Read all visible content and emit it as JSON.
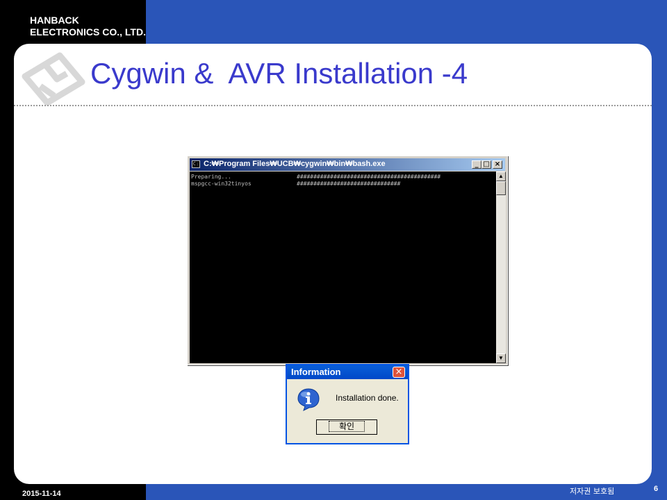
{
  "header": {
    "company_line1": "HANBACK",
    "company_line2": "ELECTRONICS CO., LTD."
  },
  "slide": {
    "title": "Cygwin &  AVR Installation -4"
  },
  "console_window": {
    "title": "C:\\Program Files\\UCB\\cygwin\\bin\\bash.exe",
    "title_display": "C:₩Program Files₩UCB₩cygwin₩bin₩bash.exe",
    "app_icon_text": "C:\\",
    "minimize_label": "_",
    "maximize_label": "□",
    "close_label": "×",
    "lines": [
      {
        "label": "Preparing...",
        "progress": "###########################################"
      },
      {
        "label": "mspgcc-win32tinyos",
        "progress": "###############################"
      }
    ]
  },
  "dialog": {
    "title": "Information",
    "close_label": "×",
    "icon": "info-icon",
    "message": "Installation done.",
    "ok_label": "확인"
  },
  "footer": {
    "date": "2015-11-14",
    "copyright": "저자권 보호됨",
    "page_number": "6"
  },
  "colors": {
    "background": "#2a55b8",
    "title": "#3a3acc",
    "content": "#ffffff"
  }
}
